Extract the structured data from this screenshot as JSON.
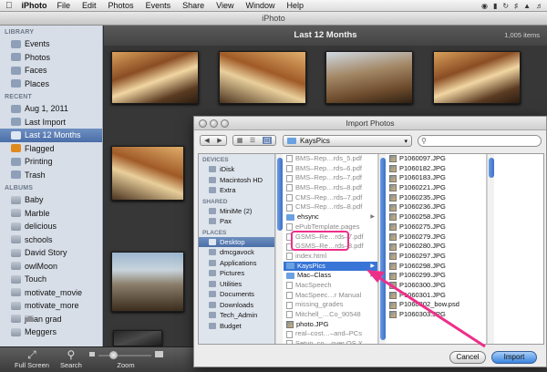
{
  "menubar": {
    "app_name": "iPhoto",
    "items": [
      "File",
      "Edit",
      "Photos",
      "Events",
      "Share",
      "View",
      "Window",
      "Help"
    ]
  },
  "window": {
    "title": "iPhoto"
  },
  "sidebar": {
    "library": {
      "heading": "LIBRARY",
      "items": [
        "Events",
        "Photos",
        "Faces",
        "Places"
      ]
    },
    "recent": {
      "heading": "RECENT",
      "items": [
        "Aug 1, 2011",
        "Last Import",
        "Last 12 Months",
        "Flagged",
        "Printing",
        "Trash"
      ],
      "selected": "Last 12 Months"
    },
    "albums": {
      "heading": "ALBUMS",
      "items": [
        "Baby",
        "Marble",
        "delicious",
        "schools",
        "David Story",
        "owlMoon",
        "Touch",
        "motivate_movie",
        "motivate_more",
        "jillian grad",
        "Meggers"
      ]
    }
  },
  "content": {
    "title": "Last 12 Months",
    "count": "1,005 items"
  },
  "toolbar": {
    "fullscreen": "Full Screen",
    "search": "Search",
    "zoom": "Zoom"
  },
  "dialog": {
    "title": "Import Photos",
    "path": "KaysPics",
    "search_placeholder": "",
    "sidebar": {
      "devices_heading": "DEVICES",
      "devices": [
        "iDisk",
        "Macintosh HD",
        "Extra"
      ],
      "shared_heading": "SHARED",
      "shared": [
        "MiniMe (2)",
        "Pax"
      ],
      "places_heading": "PLACES",
      "places": [
        "Desktop",
        "dmcgavock",
        "Applications",
        "Pictures",
        "Utilities",
        "Documents",
        "Downloads",
        "Tech_Admin",
        "Budget"
      ],
      "selected": "Desktop"
    },
    "column1": [
      {
        "name": "BMS–Rep…rds_5.pdf",
        "kind": "file",
        "dim": true
      },
      {
        "name": "BMS–Rep…rds–6.pdf",
        "kind": "file",
        "dim": true
      },
      {
        "name": "BMS–Rep…rds–7.pdf",
        "kind": "file",
        "dim": true
      },
      {
        "name": "BMS–Rep…rds–8.pdf",
        "kind": "file",
        "dim": true
      },
      {
        "name": "CMS–Rep…rds–7.pdf",
        "kind": "file",
        "dim": true
      },
      {
        "name": "CMS–Rep…rds–8.pdf",
        "kind": "file",
        "dim": true
      },
      {
        "name": "ehsync",
        "kind": "folder",
        "dim": false
      },
      {
        "name": "ePubTemplate.pages",
        "kind": "file",
        "dim": true
      },
      {
        "name": "GSMS–Re…rds–7.pdf",
        "kind": "file",
        "dim": true
      },
      {
        "name": "GSMS–Re…rds–8.pdf",
        "kind": "file",
        "dim": true
      },
      {
        "name": "index.html",
        "kind": "file",
        "dim": true
      },
      {
        "name": "KaysPics",
        "kind": "folder",
        "dim": false,
        "selected": true
      },
      {
        "name": "Mac–Class",
        "kind": "folder",
        "dim": false
      },
      {
        "name": "MacSpeech",
        "kind": "file",
        "dim": true
      },
      {
        "name": "MacSpeec…r Manual",
        "kind": "file",
        "dim": true
      },
      {
        "name": "missing_grades",
        "kind": "file",
        "dim": true
      },
      {
        "name": "Mitchell_…Co_90548",
        "kind": "file",
        "dim": true
      },
      {
        "name": "photo.JPG",
        "kind": "image",
        "dim": false
      },
      {
        "name": "real–cost…–and–PCs",
        "kind": "file",
        "dim": true
      },
      {
        "name": "Setup–co…over OS X",
        "kind": "file",
        "dim": true
      }
    ],
    "column2": [
      "P1060097.JPG",
      "P1060182.JPG",
      "P1060183.JPG",
      "P1060221.JPG",
      "P1060235.JPG",
      "P1060236.JPG",
      "P1060258.JPG",
      "P1060275.JPG",
      "P1060279.JPG",
      "P1060280.JPG",
      "P1060297.JPG",
      "P1060298.JPG",
      "P1060299.JPG",
      "P1060300.JPG",
      "P1060301.JPG",
      "P1060302_bow.psd",
      "P1060303.JPG"
    ],
    "cancel_label": "Cancel",
    "import_label": "Import"
  },
  "colors": {
    "selection": "#3875d7",
    "highlight": "#ee2f8a",
    "sidebar_bg": "#d7dee8"
  }
}
